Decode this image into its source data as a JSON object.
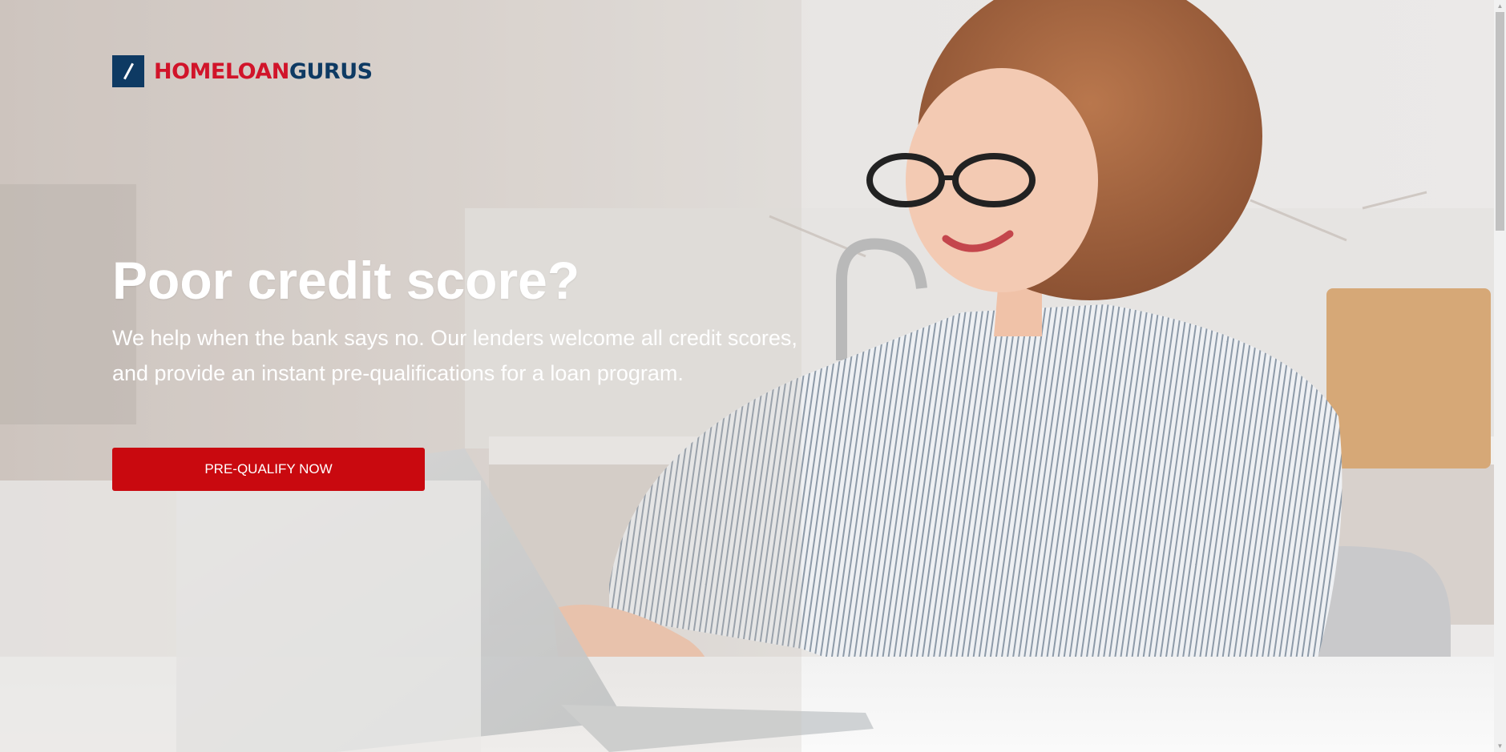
{
  "logo": {
    "brand_part1": "HOMELOAN",
    "brand_part2": "GURUS",
    "mark_icon": "slash-square-icon"
  },
  "hero": {
    "headline": "Poor credit score?",
    "subtext": "We help when the bank says no. Our lenders welcome all credit scores, and provide an instant pre-qualifications for a loan program.",
    "cta_label": "PRE-QUALIFY NOW",
    "background_image": "woman-with-glasses-typing-on-laptop-photo"
  },
  "scrollbar": {
    "up_icon": "scroll-up-arrow-icon",
    "down_icon": "scroll-down-arrow-icon"
  },
  "colors": {
    "brand_red": "#d1142a",
    "brand_navy": "#0e3a63",
    "cta_red": "#c9090f",
    "text_white": "#ffffff"
  }
}
